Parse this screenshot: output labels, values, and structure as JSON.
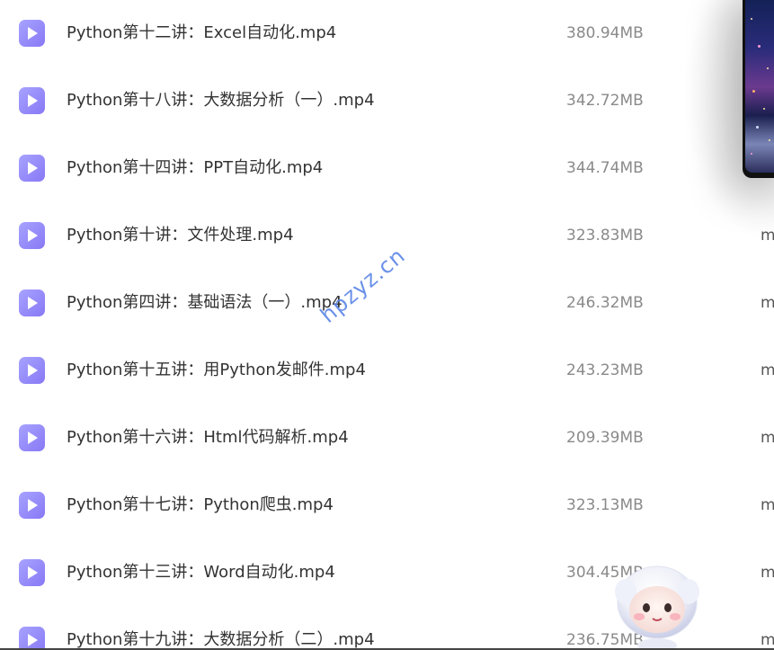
{
  "files": [
    {
      "name": "Python第十二讲：Excel自动化.mp4",
      "size": "380.94MB",
      "type": ""
    },
    {
      "name": "Python第十八讲：大数据分析（一）.mp4",
      "size": "342.72MB",
      "type": ""
    },
    {
      "name": "Python第十四讲：PPT自动化.mp4",
      "size": "344.74MB",
      "type": ""
    },
    {
      "name": "Python第十讲：文件处理.mp4",
      "size": "323.83MB",
      "type": "m"
    },
    {
      "name": "Python第四讲：基础语法（一）.mp4",
      "size": "246.32MB",
      "type": "m"
    },
    {
      "name": "Python第十五讲：用Python发邮件.mp4",
      "size": "243.23MB",
      "type": "m"
    },
    {
      "name": "Python第十六讲：Html代码解析.mp4",
      "size": "209.39MB",
      "type": "m"
    },
    {
      "name": "Python第十七讲：Python爬虫.mp4",
      "size": "323.13MB",
      "type": "m"
    },
    {
      "name": "Python第十三讲：Word自动化.mp4",
      "size": "304.45MB",
      "type": "m"
    },
    {
      "name": "Python第十九讲：大数据分析（二）.mp4",
      "size": "236.75MB",
      "type": "m"
    }
  ],
  "file_icon": "video-file-icon",
  "watermark": "hpzyz.cn",
  "colors": {
    "icon_accent": "#9b8cf7",
    "watermark": "#5a84e6",
    "name_text": "#333333",
    "size_text": "#8a8a8a"
  }
}
